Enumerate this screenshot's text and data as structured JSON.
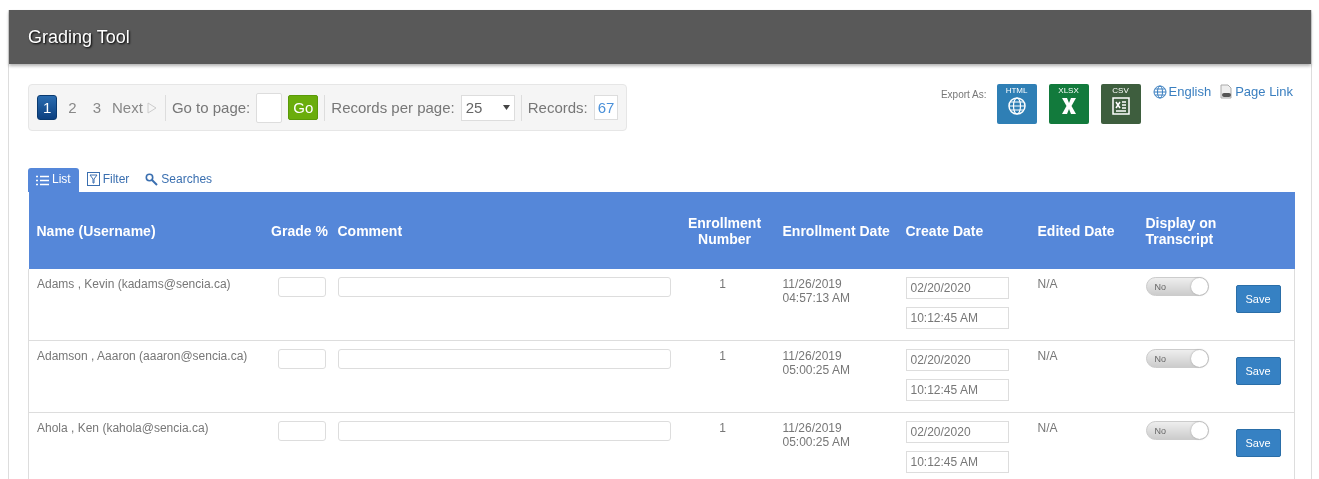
{
  "window": {
    "title": "Grading Tool"
  },
  "pager": {
    "pages": [
      {
        "label": "1",
        "selected": true
      },
      {
        "label": "2",
        "selected": false
      },
      {
        "label": "3",
        "selected": false
      }
    ],
    "next": "Next",
    "goto_label": "Go to page:",
    "go": "Go",
    "per_page_label": "Records per page:",
    "per_page": "25",
    "records_label": "Records:",
    "records": "67"
  },
  "export": {
    "label": "Export As:",
    "formats": [
      {
        "kind": "html",
        "label": "HTML"
      },
      {
        "kind": "xlsx",
        "label": "XLSX"
      },
      {
        "kind": "csv",
        "label": "CSV"
      }
    ]
  },
  "links": {
    "language": "English",
    "page_link": "Page Link"
  },
  "tabs": [
    {
      "kind": "list",
      "label": "List",
      "selected": true
    },
    {
      "kind": "filter",
      "label": "Filter",
      "selected": false
    },
    {
      "kind": "search",
      "label": "Searches",
      "selected": false
    }
  ],
  "table": {
    "columns": [
      "Name (Username)",
      "Grade %",
      "Comment",
      "Enrollment Number",
      "Enrollment Date",
      "Create Date",
      "Edited Date",
      "Display on Transcript"
    ],
    "rows": [
      {
        "name": "Adams , Kevin (kadams@sencia.ca)",
        "enrollment_number": "1",
        "enrollment_date": "11/26/2019 04:57:13 AM",
        "create_date": "02/20/2020",
        "create_time": "10:12:45 AM",
        "edited_date": "N/A",
        "display": {
          "label": "No",
          "on": false
        },
        "action": "Save"
      },
      {
        "name": "Adamson , Aaaron (aaaron@sencia.ca)",
        "enrollment_number": "1",
        "enrollment_date": "11/26/2019 05:00:25 AM",
        "create_date": "02/20/2020",
        "create_time": "10:12:45 AM",
        "edited_date": "N/A",
        "display": {
          "label": "No",
          "on": false
        },
        "action": "Save"
      },
      {
        "name": "Ahola , Ken (kahola@sencia.ca)",
        "enrollment_number": "1",
        "enrollment_date": "11/26/2019 05:00:25 AM",
        "create_date": "02/20/2020",
        "create_time": "10:12:45 AM",
        "edited_date": "N/A",
        "display": {
          "label": "No",
          "on": false
        },
        "action": "Save"
      }
    ]
  }
}
